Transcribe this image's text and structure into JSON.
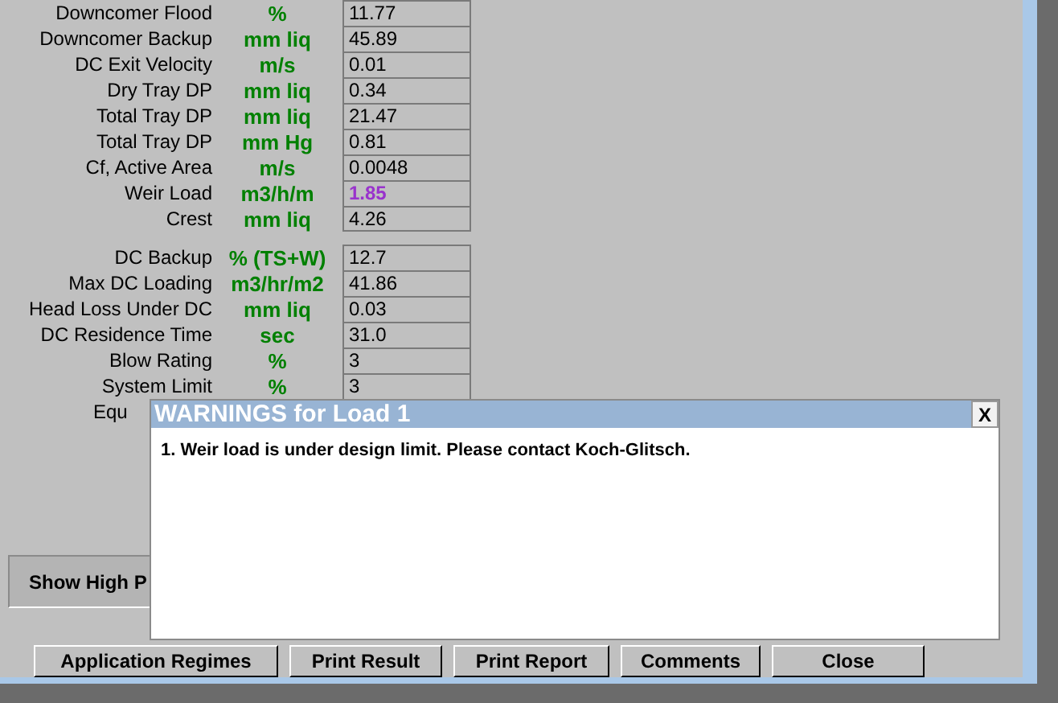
{
  "results_group_1": [
    {
      "label": "Downcomer Flood",
      "unit": "%",
      "value": "11.77",
      "highlight": false
    },
    {
      "label": "Downcomer Backup",
      "unit": "mm liq",
      "value": "45.89",
      "highlight": false
    },
    {
      "label": "DC Exit Velocity",
      "unit": "m/s",
      "value": "0.01",
      "highlight": false
    },
    {
      "label": "Dry Tray DP",
      "unit": "mm liq",
      "value": "0.34",
      "highlight": false
    },
    {
      "label": "Total Tray DP",
      "unit": "mm liq",
      "value": "21.47",
      "highlight": false
    },
    {
      "label": "Total Tray DP",
      "unit": "mm Hg",
      "value": "0.81",
      "highlight": false
    },
    {
      "label": "Cf, Active Area",
      "unit": "m/s",
      "value": "0.0048",
      "highlight": false
    },
    {
      "label": "Weir Load",
      "unit": "m3/h/m",
      "value": "1.85",
      "highlight": true
    },
    {
      "label": "Crest",
      "unit": "mm liq",
      "value": "4.26",
      "highlight": false
    }
  ],
  "results_group_2": [
    {
      "label": "DC Backup",
      "unit": "% (TS+W)",
      "value": "12.7",
      "highlight": false,
      "kind": "full"
    },
    {
      "label": "Max DC Loading",
      "unit": "m3/hr/m2",
      "value": "41.86",
      "highlight": false,
      "kind": "full"
    },
    {
      "label": "Head Loss Under DC",
      "unit": "mm liq",
      "value": "0.03",
      "highlight": false,
      "kind": "full"
    },
    {
      "label": "DC Residence Time",
      "unit": "sec",
      "value": "31.0",
      "highlight": false,
      "kind": "full"
    },
    {
      "label": "Blow Rating",
      "unit": "%",
      "value": "3",
      "highlight": false,
      "kind": "full"
    },
    {
      "label": "System Limit",
      "unit": "%",
      "value": "3",
      "highlight": false,
      "kind": "full"
    },
    {
      "label": "Equ",
      "kind": "covered"
    }
  ],
  "panel": {
    "label": "Show High P"
  },
  "buttons": [
    "Application Regimes",
    "Print Result",
    "Print Report",
    "Comments",
    "Close"
  ],
  "dialog": {
    "title": "WARNINGS for Load 1",
    "close": "X",
    "messages": [
      "1. Weir load is under design limit. Please contact Koch-Glitsch."
    ]
  }
}
